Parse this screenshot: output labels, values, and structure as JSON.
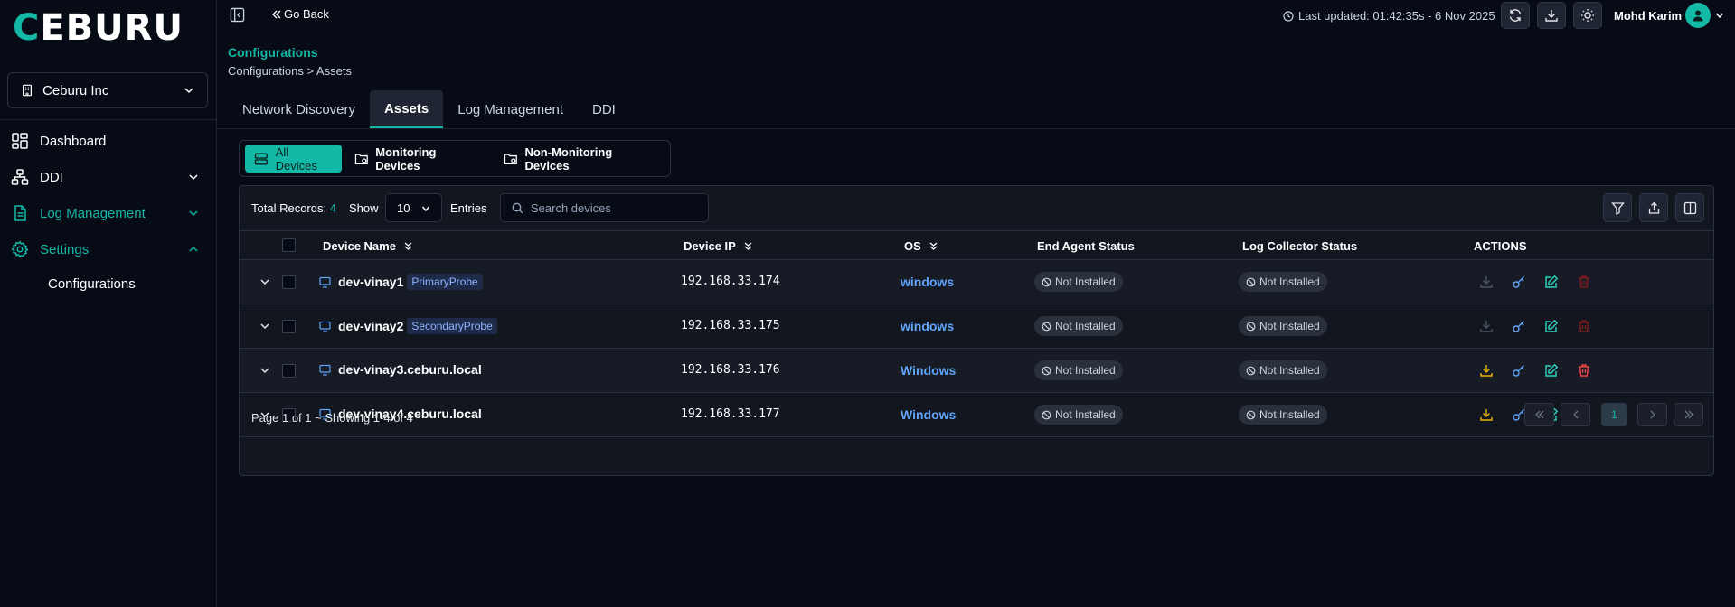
{
  "brand": {
    "logo_first": "C",
    "logo_rest": "EBURU",
    "accent": "#14b8a6"
  },
  "org_selector": {
    "value": "Ceburu Inc"
  },
  "sidebar": {
    "items": [
      {
        "label": "Dashboard",
        "icon": "dashboard-icon"
      },
      {
        "label": "DDI",
        "icon": "network-icon"
      },
      {
        "label": "Log Management",
        "icon": "file-icon"
      },
      {
        "label": "Settings",
        "icon": "gear-icon"
      }
    ],
    "sub_item": "Configurations"
  },
  "topbar": {
    "go_back": "Go Back",
    "last_updated": "Last updated: 01:42:35s - 6 Nov 2025",
    "user_name": "Mohd Karim"
  },
  "header": {
    "title": "Configurations",
    "breadcrumb": "Configurations > Assets"
  },
  "tabs": [
    "Network Discovery",
    "Assets",
    "Log Management",
    "DDI"
  ],
  "segments": [
    "All Devices",
    "Monitoring Devices",
    "Non-Monitoring Devices"
  ],
  "toolbar": {
    "total_label": "Total Records:",
    "total_count": "4",
    "show_label": "Show",
    "page_size": "10",
    "entries_label": "Entries",
    "search_placeholder": "Search devices"
  },
  "table": {
    "headers": {
      "device_name": "Device Name",
      "device_ip": "Device IP",
      "os": "OS",
      "end_agent": "End Agent Status",
      "log_collector": "Log Collector Status",
      "actions": "ACTIONS"
    },
    "rows": [
      {
        "name": "dev-vinay1",
        "probe": "PrimaryProbe",
        "ip": "192.168.33.174",
        "os": "windows",
        "end_agent": "Not Installed",
        "log_collector": "Not Installed"
      },
      {
        "name": "dev-vinay2",
        "probe": "SecondaryProbe",
        "ip": "192.168.33.175",
        "os": "windows",
        "end_agent": "Not Installed",
        "log_collector": "Not Installed"
      },
      {
        "name": "dev-vinay3.ceburu.local",
        "probe": "",
        "ip": "192.168.33.176",
        "os": "Windows",
        "end_agent": "Not Installed",
        "log_collector": "Not Installed"
      },
      {
        "name": "dev-vinay4.ceburu.local",
        "probe": "",
        "ip": "192.168.33.177",
        "os": "Windows",
        "end_agent": "Not Installed",
        "log_collector": "Not Installed"
      }
    ]
  },
  "pagination": {
    "info": "Page 1 of 1 ~ Showing 1-4 of 4",
    "current": "1"
  }
}
